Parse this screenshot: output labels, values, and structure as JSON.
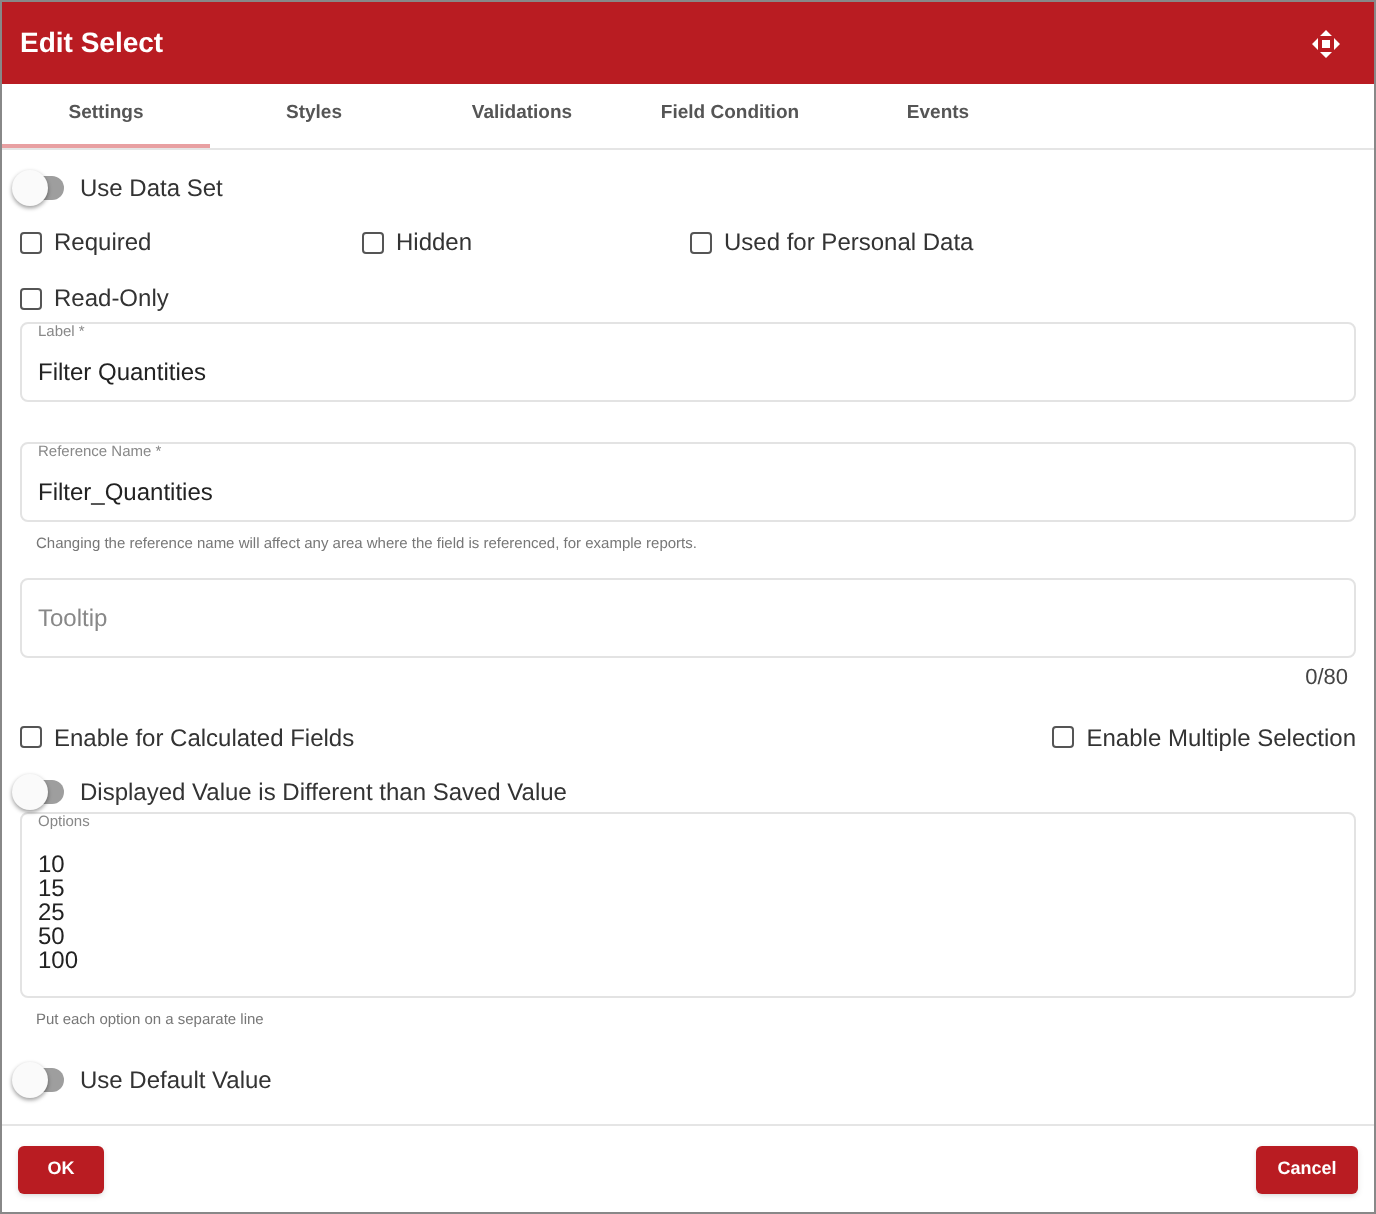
{
  "window": {
    "title": "Edit Select"
  },
  "tabs": [
    {
      "label": "Settings",
      "selected": true
    },
    {
      "label": "Styles",
      "selected": false
    },
    {
      "label": "Validations",
      "selected": false
    },
    {
      "label": "Field Condition",
      "selected": false
    },
    {
      "label": "Events",
      "selected": false
    }
  ],
  "use_data_set": {
    "label": "Use Data Set",
    "on": false
  },
  "checkboxes_row_1": [
    {
      "label": "Required",
      "checked": false
    },
    {
      "label": "Hidden",
      "checked": false
    },
    {
      "label": "Used for Personal Data",
      "checked": false
    }
  ],
  "checkbox_read_only": {
    "label": "Read-Only",
    "checked": false
  },
  "label_field": {
    "label": "Label *",
    "value": "Filter Quantities"
  },
  "reference_field": {
    "label": "Reference Name *",
    "value": "Filter_Quantities",
    "hint": "Changing the reference name will affect any area where the field is referenced, for example reports."
  },
  "tooltip_field": {
    "placeholder": "Tooltip",
    "counter": "0/80"
  },
  "checkboxes_row_2": [
    {
      "label": "Enable for Calculated Fields",
      "checked": false
    },
    {
      "label": "Enable Multiple Selection",
      "checked": false
    }
  ],
  "displayed_value_toggle": {
    "label": "Displayed Value is Different than Saved Value",
    "on": false
  },
  "options_field": {
    "label": "Options",
    "lines": [
      "10",
      "15",
      "25",
      "50",
      "100"
    ],
    "hint": "Put each option on a separate line"
  },
  "default_value_toggle": {
    "label": "Use Default Value",
    "on": false
  },
  "buttons": {
    "ok": "OK",
    "cancel": "Cancel"
  }
}
